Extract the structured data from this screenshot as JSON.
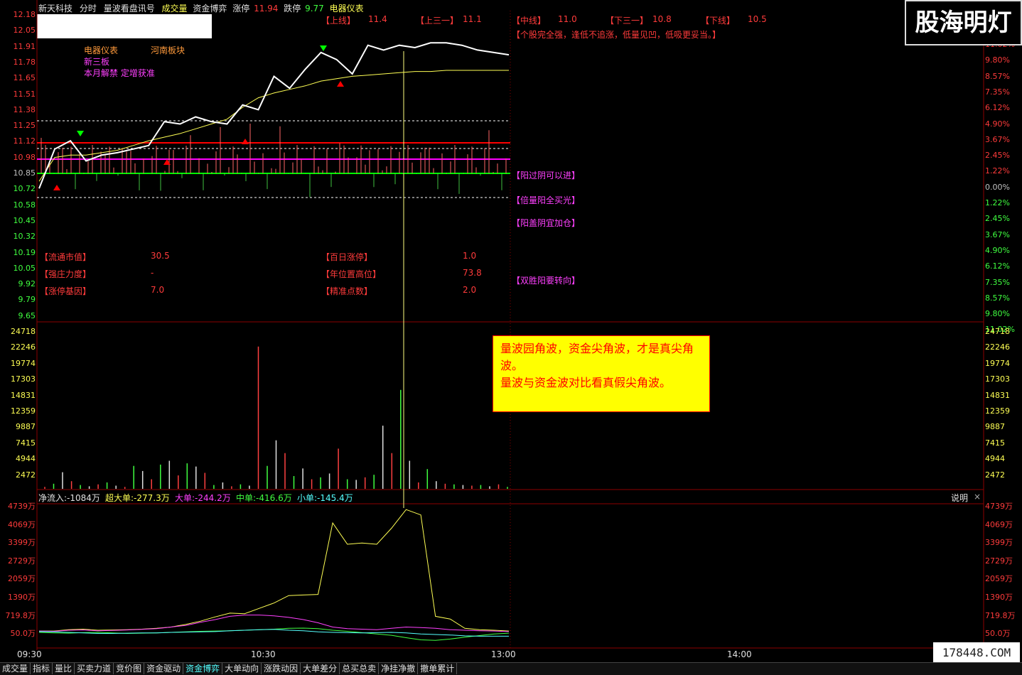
{
  "header": {
    "stock": "新天科技",
    "view": "分时",
    "indicator": "量波看盘讯号",
    "vol_label": "成交量",
    "fund_label": "资金博弈",
    "limit_up_label": "涨停",
    "limit_up": "11.94",
    "limit_down_label": "跌停",
    "limit_down": "9.77",
    "sector": "电器仪表"
  },
  "levels": {
    "upper_label": "【上线】",
    "upper": "11.4",
    "up31_label": "【上三一】",
    "up31": "11.1",
    "mid_label": "【中线】",
    "mid": "11.0",
    "down31_label": "【下三一】",
    "down31": "10.8",
    "lower_label": "【下线】",
    "lower": "10.5",
    "advice": "【个股完全强，逢低不追涨，低量见凹，低吸更妥当。】"
  },
  "tags": {
    "sector1": "电器仪表",
    "region": "河南板块",
    "board": "新三板",
    "news": "本月解禁 定增获准"
  },
  "signals": [
    "【阳过阴可以进】",
    "【倍量阳全买光】",
    "【阳盖阴宜加仓】",
    "【双胜阳要转向】"
  ],
  "stats": {
    "float_label": "【流通市值】",
    "float": "30.5",
    "limit100_label": "【百日涨停】",
    "limit100": "1.0",
    "strength_label": "【强庄力度】",
    "strength": "-",
    "yearpos_label": "【年位置高位】",
    "yearpos": "73.8",
    "gene_label": "【涨停基因】",
    "gene": "7.0",
    "precision_label": "【精准点数】",
    "precision": "2.0"
  },
  "price_axis": [
    "12.18",
    "12.05",
    "11.91",
    "11.78",
    "11.65",
    "11.51",
    "11.38",
    "11.25",
    "11.12",
    "10.98",
    "10.85",
    "10.72",
    "10.58",
    "10.45",
    "10.32",
    "10.19",
    "10.05",
    "9.92",
    "9.79",
    "9.65"
  ],
  "pct_axis": [
    "11.02%",
    "9.80%",
    "8.57%",
    "7.35%",
    "6.12%",
    "4.90%",
    "3.67%",
    "2.45%",
    "1.22%",
    "0.00%",
    "1.22%",
    "2.45%",
    "3.67%",
    "4.90%",
    "6.12%",
    "7.35%",
    "8.57%",
    "9.80%",
    "11.02%"
  ],
  "vol_axis": [
    "24718",
    "22246",
    "19774",
    "17303",
    "14831",
    "12359",
    "9887",
    "7415",
    "4944",
    "2472"
  ],
  "fund_axis": [
    "4739万",
    "4069万",
    "3399万",
    "2729万",
    "2059万",
    "1390万",
    "719.8万",
    "50.0万"
  ],
  "fund_header": {
    "net": "净流入:-1084万",
    "super": "超大单:-277.3万",
    "big": "大单:-244.2万",
    "mid": "中单:-416.6万",
    "small": "小单:-145.4万",
    "explain": "说明",
    "close": "×"
  },
  "times": [
    "09:30",
    "10:30",
    "13:00",
    "14:00"
  ],
  "callout": "量波园角波，资金尖角波，才是真尖角波。\n量波与资金波对比看真假尖角波。",
  "logo": "股海明灯",
  "watermark": "178448.COM",
  "tabs": [
    "成交量",
    "指标",
    "量比",
    "买卖力道",
    "竞价图",
    "资金驱动",
    "资金博弈",
    "大单动向",
    "涨跌动因",
    "大单差分",
    "总买总卖",
    "净挂净撤",
    "撤单累计"
  ],
  "active_tab": "资金博弈",
  "chart_data": [
    {
      "type": "line",
      "title": "分时",
      "x": [
        "09:30",
        "10:30",
        "13:00",
        "14:00"
      ],
      "series": [
        {
          "name": "price",
          "points": [
            10.72,
            11.05,
            11.12,
            10.95,
            11.0,
            11.02,
            11.05,
            11.08,
            11.28,
            11.26,
            11.32,
            11.28,
            11.26,
            11.42,
            11.38,
            11.66,
            11.56,
            11.72,
            11.86,
            11.8,
            11.68,
            11.92,
            11.88,
            11.92,
            11.9,
            11.94,
            11.94,
            11.92,
            11.88,
            11.86,
            11.84
          ]
        },
        {
          "name": "avg",
          "points": [
            10.78,
            10.98,
            11.0,
            11.0,
            11.02,
            11.04,
            11.08,
            11.12,
            11.15,
            11.18,
            11.22,
            11.26,
            11.3,
            11.4,
            11.48,
            11.52,
            11.55,
            11.58,
            11.62,
            11.64,
            11.66,
            11.67,
            11.68,
            11.69,
            11.7,
            11.7,
            11.71,
            11.71,
            11.71,
            11.71,
            11.71
          ]
        }
      ],
      "ylim": [
        9.65,
        12.18
      ]
    },
    {
      "type": "bar",
      "title": "成交量",
      "values": [
        300,
        800,
        2600,
        1200,
        600,
        400,
        700,
        1000,
        500,
        300,
        3600,
        2800,
        1500,
        3800,
        4400,
        2100,
        4000,
        3500,
        2500,
        600,
        1000,
        400,
        700,
        500,
        22300,
        3600,
        7600,
        5600,
        2000,
        3200,
        1500,
        1800,
        2400,
        6300,
        1500,
        1400,
        1800,
        2200,
        9900,
        5600,
        15500,
        4400,
        1000,
        3100,
        1200,
        800,
        700,
        600,
        500,
        600,
        400,
        700,
        300
      ],
      "ylim": [
        0,
        24718
      ]
    },
    {
      "type": "line",
      "title": "资金博弈",
      "series": [
        {
          "name": "超大单",
          "points": [
            50,
            50,
            100,
            120,
            80,
            90,
            100,
            120,
            150,
            200,
            300,
            420,
            580,
            720,
            700,
            900,
            1100,
            1380,
            1400,
            1420,
            4100,
            3300,
            3350,
            3300,
            3900,
            4600,
            4400,
            600,
            500,
            150,
            100,
            80,
            50
          ]
        },
        {
          "name": "大单",
          "points": [
            50,
            40,
            80,
            90,
            60,
            70,
            90,
            110,
            140,
            200,
            260,
            380,
            480,
            600,
            650,
            650,
            620,
            560,
            480,
            360,
            200,
            140,
            120,
            100,
            150,
            200,
            180,
            150,
            100,
            80,
            60,
            50,
            30
          ]
        },
        {
          "name": "中单",
          "points": [
            0,
            -20,
            -30,
            -10,
            0,
            -20,
            -40,
            -30,
            -20,
            0,
            20,
            40,
            50,
            60,
            80,
            100,
            120,
            150,
            160,
            140,
            80,
            40,
            -10,
            -60,
            -110,
            -200,
            -280,
            -300,
            -250,
            -180,
            -120,
            -60,
            -30
          ]
        },
        {
          "name": "小单",
          "points": [
            30,
            20,
            0,
            -20,
            -40,
            -40,
            -30,
            -20,
            -20,
            0,
            10,
            20,
            30,
            60,
            80,
            100,
            110,
            80,
            60,
            20,
            0,
            -10,
            -20,
            -10,
            0,
            -20,
            -60,
            -80,
            -100,
            -130,
            -145,
            -145,
            -145
          ]
        }
      ],
      "ylim": [
        -400,
        4739
      ]
    }
  ]
}
